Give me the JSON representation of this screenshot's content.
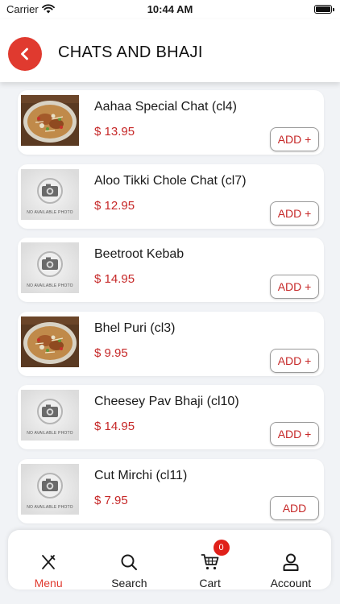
{
  "status_bar": {
    "carrier": "Carrier",
    "time": "10:44 AM"
  },
  "header": {
    "title": "CHATS AND BHAJI"
  },
  "colors": {
    "accent": "#e03a2f",
    "price": "#c62828",
    "badge": "#e0201a"
  },
  "items": [
    {
      "name": "Aahaa Special Chat (cl4)",
      "price": "$ 13.95",
      "button": "ADD +",
      "photo": "food-photo"
    },
    {
      "name": "Aloo Tikki Chole Chat (cl7)",
      "price": "$ 12.95",
      "button": "ADD +",
      "photo": "no-photo-placeholder",
      "placeholder_text": "NO AVAILABLE PHOTO"
    },
    {
      "name": "Beetroot Kebab",
      "price": "$ 14.95",
      "button": "ADD +",
      "photo": "no-photo-placeholder",
      "placeholder_text": "NO AVAILABLE PHOTO"
    },
    {
      "name": "Bhel Puri (cl3)",
      "price": "$ 9.95",
      "button": "ADD +",
      "photo": "food-photo"
    },
    {
      "name": "Cheesey Pav Bhaji (cl10)",
      "price": "$ 14.95",
      "button": "ADD +",
      "photo": "no-photo-placeholder",
      "placeholder_text": "NO AVAILABLE PHOTO"
    },
    {
      "name": "Cut Mirchi (cl11)",
      "price": "$ 7.95",
      "button": "ADD",
      "photo": "no-photo-placeholder",
      "placeholder_text": "NO AVAILABLE PHOTO"
    }
  ],
  "bottom_nav": {
    "items": [
      {
        "label": "Menu",
        "icon": "fork-knife-icon",
        "active": true
      },
      {
        "label": "Search",
        "icon": "search-icon",
        "active": false
      },
      {
        "label": "Cart",
        "icon": "cart-icon",
        "active": false,
        "badge": "0"
      },
      {
        "label": "Account",
        "icon": "user-icon",
        "active": false
      }
    ]
  }
}
